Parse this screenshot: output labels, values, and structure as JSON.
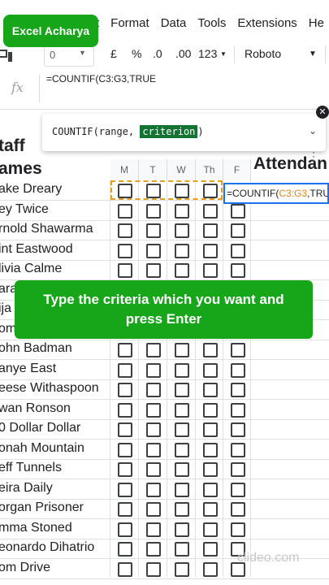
{
  "brand": "Excel Acharya",
  "menu": [
    "t",
    "Format",
    "Data",
    "Tools",
    "Extensions",
    "He"
  ],
  "toolbar": {
    "zoom": "0",
    "currency": "£",
    "percent": "%",
    "dec_down": ".0",
    "dec_up": ".00",
    "format_123": "123",
    "font": "Roboto"
  },
  "formula_bar": {
    "fx": "fx",
    "text": "=COUNTIF(C3:G3,TRUE"
  },
  "hint": {
    "fn": "COUNTIF(range, ",
    "highlight": "criterion",
    "tail": ")"
  },
  "sheet": {
    "title_line1": "taff",
    "title_line2": "ames",
    "attendance_label": "Attendan",
    "day_headers": [
      "M",
      "T",
      "W",
      "Th",
      "F"
    ],
    "names": [
      "ake Dreary",
      "ey Twice",
      "rnold Shawarma",
      "int Eastwood",
      "livia Calme",
      "ara",
      "ija",
      "om",
      "ohn Badman",
      "anye East",
      "eese Withaspoon",
      "wan Ronson",
      "0 Dollar Dollar",
      "onah Mountain",
      "eff Tunnels",
      "eira Daily",
      "organ Prisoner",
      "mma Stoned",
      "eonardo Dihatrio",
      "om Drive"
    ]
  },
  "active_cell": {
    "prefix": "=COUNTIF(",
    "ref": "C3:G3",
    "suffix": ",TRU"
  },
  "banner": "Type the criteria which you want and press Enter",
  "watermark": "clideo.com"
}
